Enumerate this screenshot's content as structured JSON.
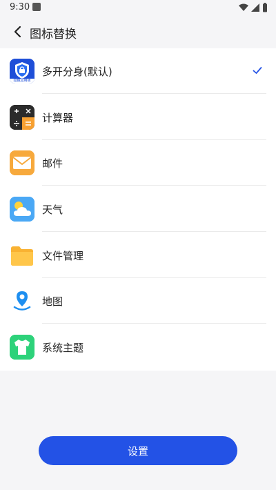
{
  "status_bar": {
    "time": "9:30"
  },
  "header": {
    "title": "图标替换"
  },
  "icon_options": [
    {
      "label": "多开分身(默认)",
      "icon": "default-shield-icon",
      "icon_caption": "隐藏应用锁",
      "selected": true
    },
    {
      "label": "计算器",
      "icon": "calculator-icon",
      "selected": false
    },
    {
      "label": "邮件",
      "icon": "mail-icon",
      "selected": false
    },
    {
      "label": "天气",
      "icon": "weather-icon",
      "selected": false
    },
    {
      "label": "文件管理",
      "icon": "folder-icon",
      "selected": false
    },
    {
      "label": "地图",
      "icon": "map-pin-icon",
      "selected": false
    },
    {
      "label": "系统主题",
      "icon": "theme-shirt-icon",
      "selected": false
    }
  ],
  "actions": {
    "set_label": "设置"
  },
  "colors": {
    "accent": "#2352e6",
    "check": "#2352e6"
  }
}
